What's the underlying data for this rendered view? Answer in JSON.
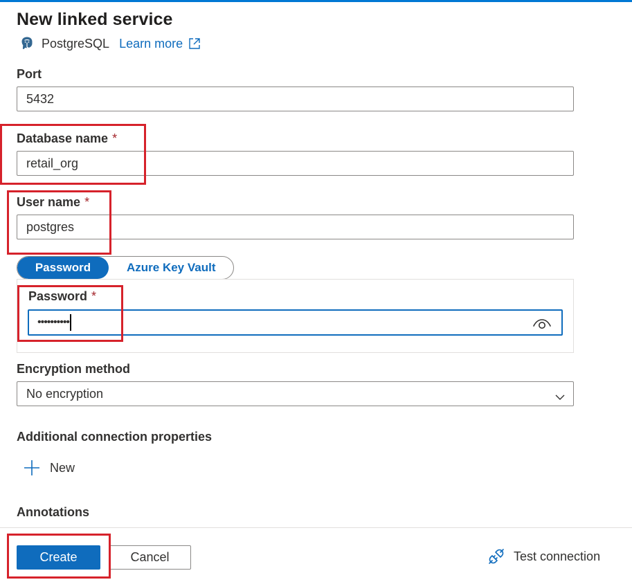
{
  "panel": {
    "title": "New linked service",
    "connector_name": "PostgreSQL",
    "learn_more": "Learn more"
  },
  "form": {
    "port": {
      "label": "Port",
      "value": "5432"
    },
    "database_name": {
      "label": "Database name",
      "required_mark": "*",
      "value": "retail_org"
    },
    "user_name": {
      "label": "User name",
      "required_mark": "*",
      "value": "postgres"
    },
    "auth_toggle": {
      "selected": "Password",
      "other": "Azure Key Vault"
    },
    "password": {
      "label": "Password",
      "required_mark": "*",
      "masked_value": "••••••••••"
    },
    "encryption_method": {
      "label": "Encryption method",
      "selected": "No encryption"
    },
    "additional_properties": {
      "label": "Additional connection properties",
      "new_label": "New"
    },
    "annotations": {
      "label": "Annotations"
    }
  },
  "footer": {
    "create_label": "Create",
    "cancel_label": "Cancel",
    "test_connection_label": "Test connection"
  },
  "icons": {
    "connector": "postgresql-elephant-icon",
    "external_link": "external-link-icon",
    "reveal_password": "eye-icon",
    "dropdown": "chevron-down-icon",
    "add": "plus-icon",
    "test_connection": "plug-connection-icon"
  },
  "colors": {
    "accent": "#0f6cbd",
    "required": "#a4262c",
    "highlight_box": "#d6222b",
    "top_bar": "#0078d4"
  }
}
